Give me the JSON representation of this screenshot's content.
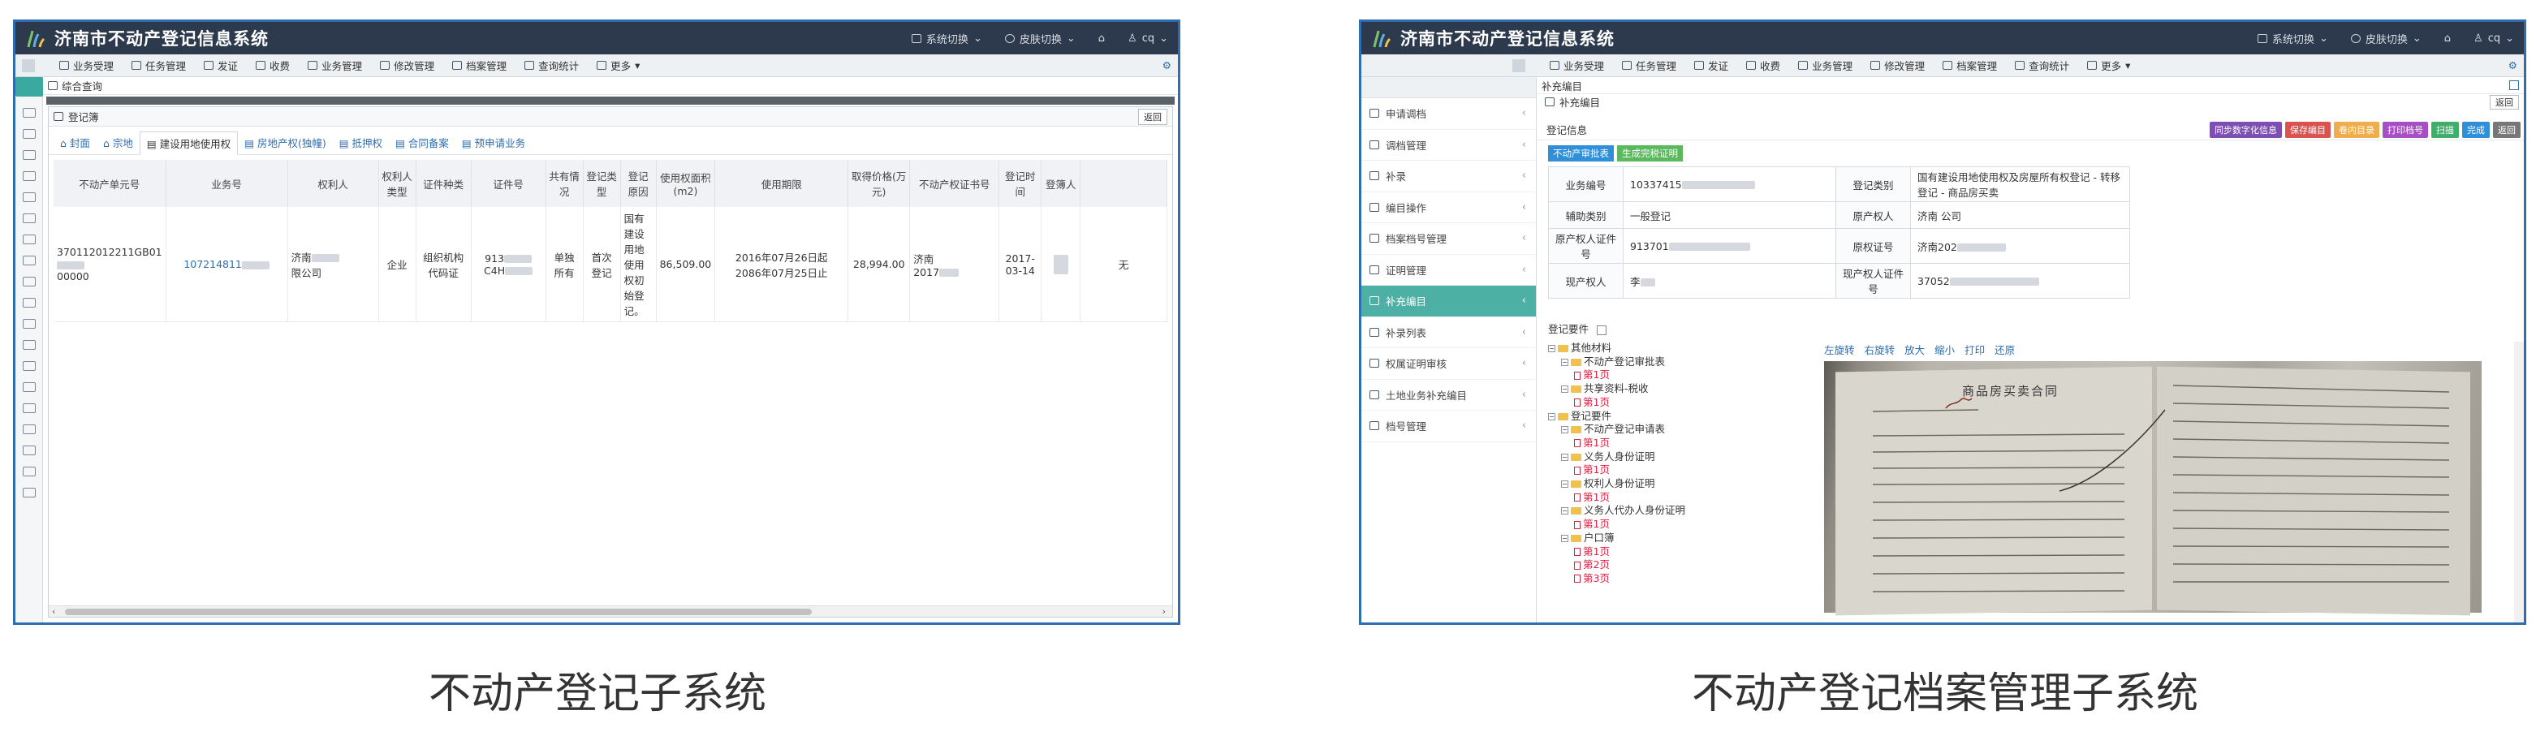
{
  "app_title": "济南市不动产登记信息系统",
  "header_right": [
    "系统切换",
    "皮肤切换",
    "cq"
  ],
  "toolbar": [
    "业务受理",
    "任务管理",
    "发证",
    "收费",
    "业务管理",
    "修改管理",
    "档案管理",
    "查询统计",
    "更多"
  ],
  "captions": [
    "不动产登记子系统",
    "不动产登记档案管理子系统"
  ],
  "colors": {
    "header_bg": "#2d3a4d",
    "frame": "#2e6db0",
    "teal": "#4db0a4"
  },
  "shot1": {
    "breadcrumb": "综合查询",
    "panel_title": "登记簿",
    "back_label": "返回",
    "tabs": [
      "封面",
      "宗地",
      "建设用地使用权",
      "房地产权(独幢)",
      "抵押权",
      "合同备案",
      "预申请业务"
    ],
    "active_tab": 2,
    "table_headers": [
      "不动产单元号",
      "业务号",
      "权利人",
      "权利人类型",
      "证件种类",
      "证件号",
      "共有情况",
      "登记类型",
      "登记原因",
      "使用权面积(m2)",
      "使用期限",
      "取得价格(万元)",
      "不动产权证书号",
      "登记时间",
      "登簿人",
      ""
    ],
    "row": [
      "370112012211GB01",
      "00000",
      "107214811",
      "济南",
      "限公司",
      "企业",
      "组织机构代码证",
      "913",
      "C4H",
      "单独所有",
      "首次登记",
      "国有建设用地使用权初始登记。",
      "86,509.00",
      "2016年07月26日起",
      "2086年07月25日止",
      "28,994.00",
      "济南",
      "2017",
      "2017-03-14",
      "",
      "无"
    ]
  },
  "shot2": {
    "side_items": [
      "申请调档",
      "调档管理",
      "补录",
      "编目操作",
      "档案档号管理",
      "证明管理",
      "补充编目",
      "补录列表",
      "权属证明审核",
      "土地业务补充编目",
      "档号管理"
    ],
    "active_side": 6,
    "breadcrumb": "补充编目",
    "sub_title": "补充编目",
    "back_label": "返回",
    "info_header": "登记信息",
    "action_buttons": [
      {
        "label": "同步数字化信息",
        "color": "#7e4fb2"
      },
      {
        "label": "保存编目",
        "color": "#d9534f"
      },
      {
        "label": "卷内目录",
        "color": "#f0ad4e"
      },
      {
        "label": "打印档号",
        "color": "#a64fc4"
      },
      {
        "label": "扫描",
        "color": "#3fae6a"
      },
      {
        "label": "完成",
        "color": "#2f8fd8"
      },
      {
        "label": "返回",
        "color": "#777777"
      }
    ],
    "tags": [
      {
        "label": "不动产审批表",
        "color": "#2f8fd8"
      },
      {
        "label": "生成完税证明",
        "color": "#5cb85c"
      }
    ],
    "info_rows": [
      [
        "业务编号",
        "10337415",
        "登记类别",
        "国有建设用地使用权及房屋所有权登记 - 转移登记 - 商品房买卖"
      ],
      [
        "辅助类别",
        "一般登记",
        "原产权人",
        "济南 公司"
      ],
      [
        "原产权人证件号",
        "913701",
        "原权证号",
        "济南202"
      ],
      [
        "现产权人",
        "李",
        "现产权人证件号",
        "37052"
      ]
    ],
    "requirements_label": "登记要件",
    "tree": [
      {
        "lvl": 0,
        "t": "folder",
        "label": "其他材料"
      },
      {
        "lvl": 1,
        "t": "folder",
        "label": "不动产登记审批表"
      },
      {
        "lvl": 2,
        "t": "page",
        "label": "第1页"
      },
      {
        "lvl": 1,
        "t": "folder",
        "label": "共享资料-税收"
      },
      {
        "lvl": 2,
        "t": "page",
        "label": "第1页"
      },
      {
        "lvl": 0,
        "t": "blank",
        "label": ""
      },
      {
        "lvl": 0,
        "t": "folder",
        "label": "登记要件"
      },
      {
        "lvl": 1,
        "t": "folder",
        "label": "不动产登记申请表"
      },
      {
        "lvl": 2,
        "t": "page",
        "label": "第1页"
      },
      {
        "lvl": 1,
        "t": "folder",
        "label": "义务人身份证明"
      },
      {
        "lvl": 2,
        "t": "page",
        "label": "第1页"
      },
      {
        "lvl": 1,
        "t": "folder",
        "label": "权利人身份证明"
      },
      {
        "lvl": 2,
        "t": "page",
        "label": "第1页"
      },
      {
        "lvl": 1,
        "t": "folder",
        "label": "义务人代办人身份证明"
      },
      {
        "lvl": 2,
        "t": "page",
        "label": "第1页"
      },
      {
        "lvl": 1,
        "t": "folder",
        "label": "户口簿"
      },
      {
        "lvl": 2,
        "t": "page",
        "label": "第1页"
      },
      {
        "lvl": 2,
        "t": "page",
        "label": "第2页"
      },
      {
        "lvl": 2,
        "t": "page",
        "label": "第3页"
      }
    ],
    "viewer_tools": [
      "左旋转",
      "右旋转",
      "放大",
      "缩小",
      "打印",
      "还原"
    ],
    "doc_title": "商品房买卖合同"
  }
}
